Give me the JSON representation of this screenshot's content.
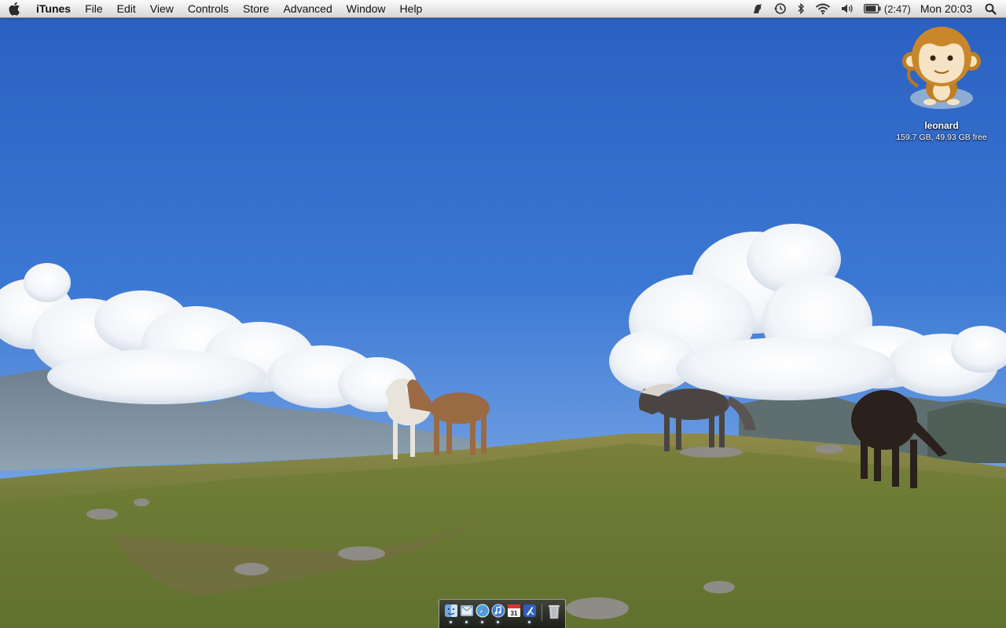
{
  "menubar": {
    "app_name": "iTunes",
    "menus": [
      "File",
      "Edit",
      "View",
      "Controls",
      "Store",
      "Advanced",
      "Window",
      "Help"
    ],
    "status_icons": [
      "growl-icon",
      "time-machine-icon",
      "bluetooth-icon",
      "wifi-icon",
      "volume-icon",
      "battery-icon",
      "spotlight-icon"
    ],
    "battery_time": "(2:47)",
    "clock": "Mon 20:03"
  },
  "desktop": {
    "drive": {
      "name": "leonard",
      "info": "159.7 GB, 49.93 GB free",
      "icon": "monkey-drive-icon"
    }
  },
  "dock": {
    "items": [
      {
        "name": "finder",
        "icon": "finder-icon",
        "running": true
      },
      {
        "name": "mail",
        "icon": "mail-icon",
        "running": true
      },
      {
        "name": "safari",
        "icon": "safari-icon",
        "running": true
      },
      {
        "name": "itunes",
        "icon": "itunes-icon",
        "running": true
      },
      {
        "name": "ical",
        "icon": "calendar-icon",
        "running": false,
        "date": "31"
      },
      {
        "name": "xcode",
        "icon": "xcode-icon",
        "running": true
      },
      {
        "name": "trash",
        "icon": "trash-icon",
        "running": false
      }
    ]
  }
}
